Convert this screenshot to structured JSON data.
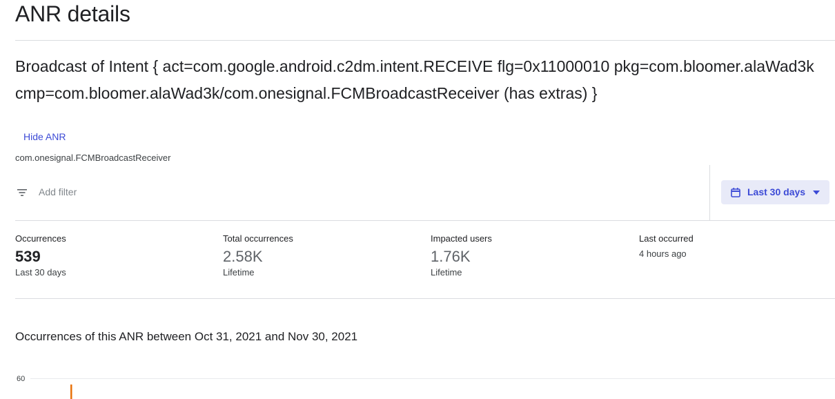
{
  "header": {
    "title": "ANR details"
  },
  "anr": {
    "title": "Broadcast of Intent { act=com.google.android.c2dm.intent.RECEIVE flg=0x11000010 pkg=com.bloomer.alaWad3k cmp=com.bloomer.alaWad3k/com.onesignal.FCMBroadcastReceiver (has extras) }",
    "hide_label": "Hide ANR",
    "receiver": "com.onesignal.FCMBroadcastReceiver"
  },
  "filter": {
    "placeholder": "Add filter",
    "icon": "filter-icon",
    "date_range": {
      "label": "Last 30 days",
      "icon": "calendar-icon",
      "caret": "chevron-down-icon"
    }
  },
  "stats": [
    {
      "label": "Occurrences",
      "value": "539",
      "sub": "Last 30 days"
    },
    {
      "label": "Total occurrences",
      "value": "2.58K",
      "sub": "Lifetime"
    },
    {
      "label": "Impacted users",
      "value": "1.76K",
      "sub": "Lifetime"
    },
    {
      "label": "Last occurred",
      "value": "",
      "sub": "4 hours ago"
    }
  ],
  "chart": {
    "title": "Occurrences of this ANR between Oct 31, 2021 and Nov 30, 2021"
  },
  "chart_data": {
    "type": "bar",
    "title": "Occurrences of this ANR between Oct 31, 2021 and Nov 30, 2021",
    "xlabel": "",
    "ylabel": "",
    "yticks": [
      "60"
    ],
    "ylim_top": 60,
    "series": [
      {
        "color": "#e8710a"
      }
    ]
  },
  "colors": {
    "accent": "#3c4ad6",
    "bar": "#e8710a",
    "divider": "#dadce0"
  }
}
